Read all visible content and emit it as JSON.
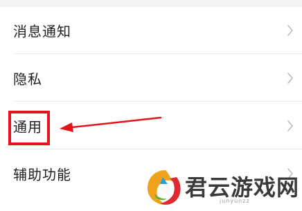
{
  "settings": {
    "items": [
      {
        "label": "消息通知"
      },
      {
        "label": "隐私"
      },
      {
        "label": "通用"
      },
      {
        "label": "辅助功能"
      }
    ]
  },
  "annotation": {
    "highlight_color": "#e1151b",
    "highlighted_item": "通用"
  },
  "watermark": {
    "brand": "君云游戏网",
    "subtext": "junyunzz"
  },
  "icons": {
    "row_chevron": "chevron-right-icon",
    "watermark_logo": "swirl-logo-icon"
  }
}
